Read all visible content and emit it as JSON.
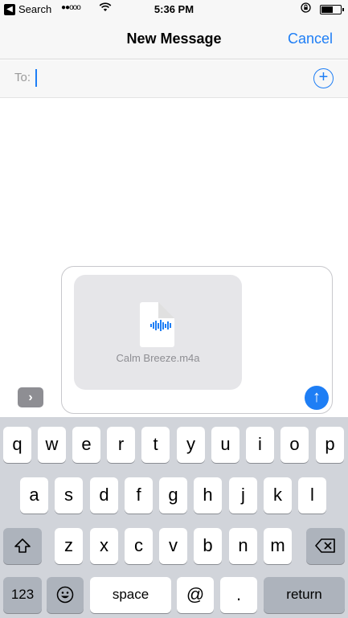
{
  "status_bar": {
    "back_app": "Search",
    "time": "5:36 PM",
    "signal_dots": "●●ooo"
  },
  "nav": {
    "title": "New Message",
    "cancel": "Cancel"
  },
  "to_field": {
    "label": "To:",
    "value": ""
  },
  "compose": {
    "attachment_name": "Calm Breeze.m4a"
  },
  "keyboard": {
    "row1": [
      "q",
      "w",
      "e",
      "r",
      "t",
      "y",
      "u",
      "i",
      "o",
      "p"
    ],
    "row2": [
      "a",
      "s",
      "d",
      "f",
      "g",
      "h",
      "j",
      "k",
      "l"
    ],
    "row3": [
      "z",
      "x",
      "c",
      "v",
      "b",
      "n",
      "m"
    ],
    "numbers_key": "123",
    "space_key": "space",
    "at_key": "@",
    "dot_key": ".",
    "return_key": "return"
  },
  "colors": {
    "accent": "#1e7ef5",
    "keyboard_bg": "#d1d4da",
    "func_key": "#adb3bc"
  }
}
